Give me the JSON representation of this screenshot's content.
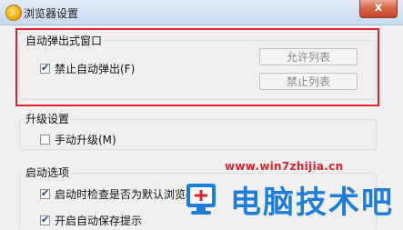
{
  "window": {
    "title": "浏览器设置",
    "close_symbol": "x"
  },
  "popup_group": {
    "label": "自动弹出式窗口",
    "block_checkbox": {
      "label": "禁止自动弹出(F)",
      "checked": true
    },
    "allow_list_button": "允许列表",
    "block_list_button": "禁止列表"
  },
  "upgrade_group": {
    "label": "升级设置",
    "manual_checkbox": {
      "label": "手动升级(M)",
      "checked": false
    }
  },
  "startup_group": {
    "label": "启动选项",
    "default_check_checkbox": {
      "label": "启动时检查是否为默认浏览器",
      "checked": true
    },
    "autosave_checkbox": {
      "label": "开启自动保存提示",
      "checked": true
    }
  },
  "watermark": {
    "url": "www.win7zhijia.cn",
    "brand_text": "电脑技术吧"
  },
  "colors": {
    "highlight_box": "#e0202e",
    "watermark_blue": "#1e7dd8",
    "close_button": "#c7452a"
  }
}
